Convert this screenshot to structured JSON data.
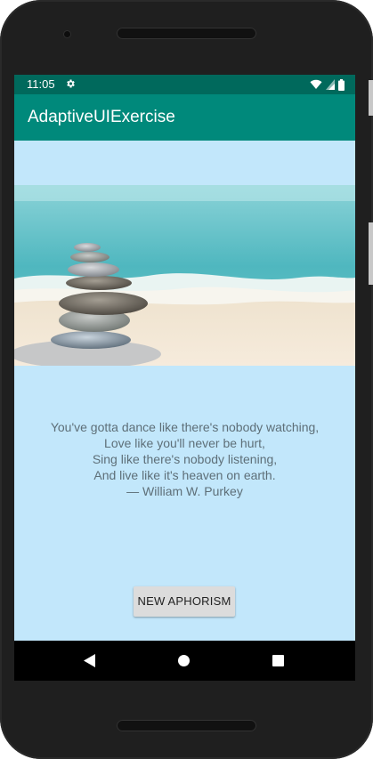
{
  "status_bar": {
    "time": "11:05",
    "settings_icon": "gear-icon",
    "wifi_icon": "wifi-icon",
    "signal_icon": "cell-signal-icon",
    "battery_icon": "battery-icon"
  },
  "app_bar": {
    "title": "AdaptiveUIExercise"
  },
  "content": {
    "quote_lines": [
      "You've gotta dance like there's nobody watching,",
      "Love like you'll never be hurt,",
      "Sing like there's nobody listening,",
      "And live like it's heaven on earth.",
      "— William W. Purkey"
    ],
    "new_button_label": "NEW APHORISM"
  },
  "navigation": {
    "back_icon": "back-triangle-icon",
    "home_icon": "home-circle-icon",
    "recents_icon": "recents-square-icon"
  },
  "colors": {
    "status_bar": "#00695c",
    "app_bar": "#00897b",
    "background": "#c2e7fb",
    "quote_text": "#5e6f78",
    "button": "#dcdcdc"
  }
}
